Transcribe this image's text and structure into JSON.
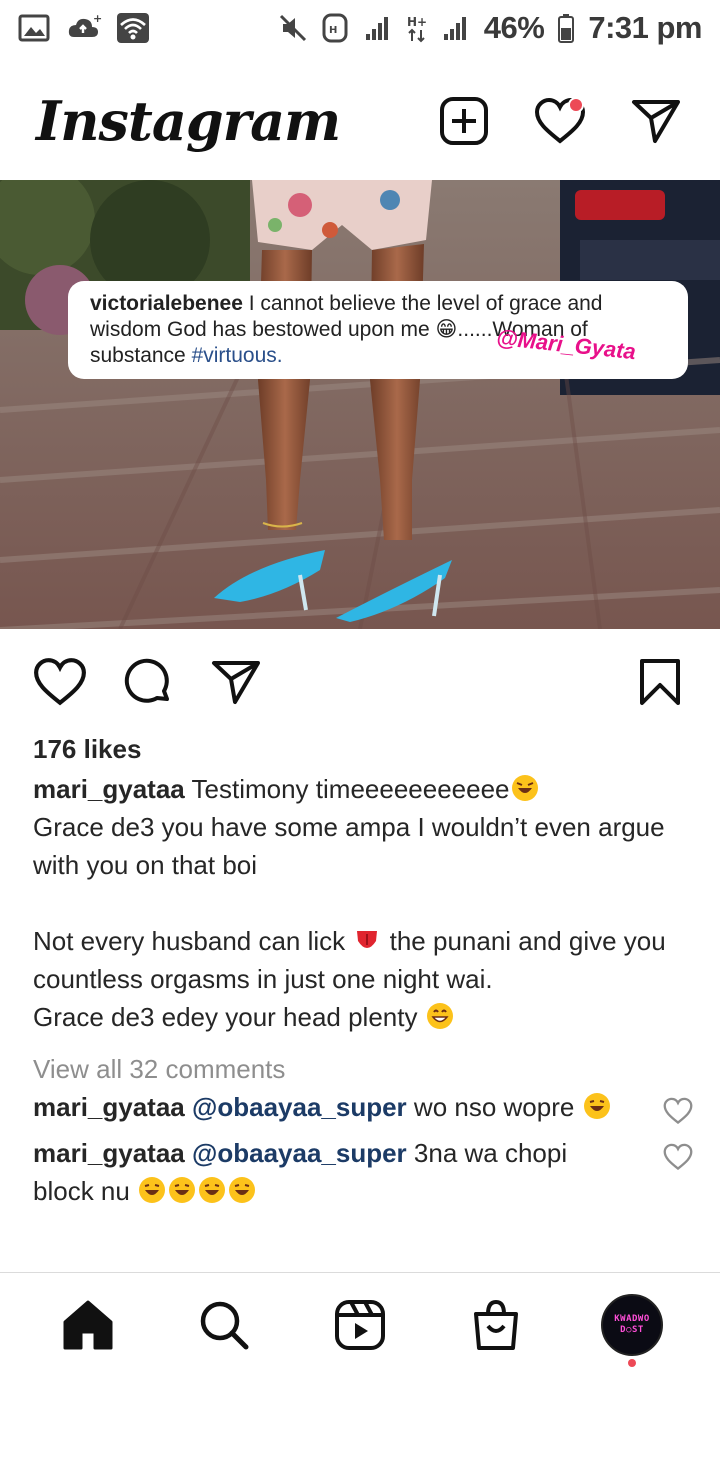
{
  "status_bar": {
    "battery": "46%",
    "time": "7:31 pm",
    "icons": [
      "image-icon",
      "cloud-upload-icon",
      "wifi-icon",
      "mute-icon",
      "hd-icon",
      "signal-icon",
      "hplus-icon",
      "signal-icon",
      "battery-icon"
    ]
  },
  "header": {
    "logo": "Instagram",
    "icons": [
      "new-post-icon",
      "heart-icon",
      "direct-message-icon"
    ],
    "notification_color": "#ed4956"
  },
  "post": {
    "overlay": {
      "username": "victorialebenee",
      "text": " I cannot believe the level of grace and wisdom God has bestowed upon me 😁......Woman of substance ",
      "hashtag": "#virtuous.",
      "watermark": "@Mari_Gyata"
    },
    "actions": [
      "like-icon",
      "comment-icon",
      "share-icon",
      "save-icon"
    ],
    "likes": "176 likes",
    "caption": {
      "username": "mari_gyataa",
      "line1": " Testimony timeeeeeeeeeee",
      "line2": "Grace de3 you have some ampa I wouldn’t even argue with you on that boi",
      "line3": "Not every husband can lick ",
      "line4": " the punani and give you countless orgasms in just one night wai.",
      "line5": "Grace de3 edey your head plenty "
    },
    "view_all_comments": "View all 32 comments",
    "comments": [
      {
        "username": "mari_gyataa",
        "mention": "@obaayaa_super",
        "text": " wo nso wopre "
      },
      {
        "username": "mari_gyataa",
        "mention": "@obaayaa_super",
        "text": " 3na wa chopi block nu "
      }
    ]
  },
  "bottom_nav": {
    "items": [
      "home-icon",
      "search-icon",
      "reels-icon",
      "shop-icon",
      "profile-avatar"
    ],
    "avatar_line1": "KWADWO",
    "avatar_line2": "D○ST"
  }
}
